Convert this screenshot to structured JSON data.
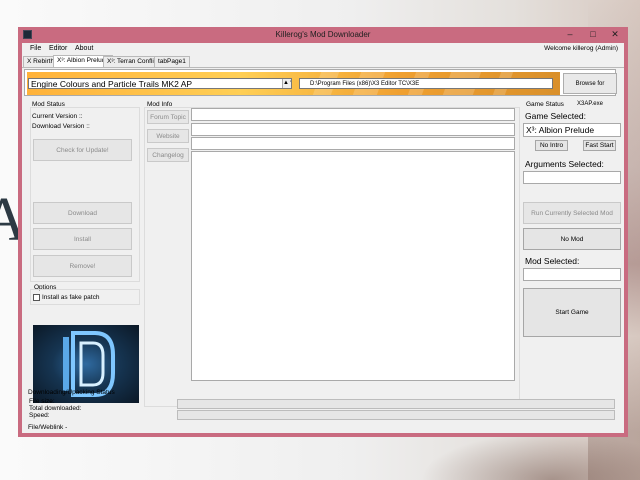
{
  "window": {
    "title": "Killerog's Mod Downloader",
    "minimize": "–",
    "maximize": "□",
    "close": "✕"
  },
  "desktop": {
    "background_letters": "AL"
  },
  "menu": {
    "file": "File",
    "editor": "Editor",
    "about": "About",
    "welcome": "Welcome killerog (Admin)"
  },
  "tabs": [
    "X Rebirth",
    "X³: Albion Prelude",
    "X³: Terran Conflict",
    "tabPage1"
  ],
  "banner": {
    "mod_selected": "Engine Colours and Particle Trails MK2 AP",
    "path": "D:\\Program Files (x86)\\X3 Editor TC\\X3E",
    "browse": "Browse for X3AP.exe"
  },
  "mod_status": {
    "title": "Mod Status",
    "current_version": "Current Version ::",
    "download_version": "Download Version ::",
    "check_update": "Check for Update!",
    "download": "Download",
    "install": "Install",
    "remove": "Remove!"
  },
  "options": {
    "title": "Options",
    "fake_patch": "Install as fake patch"
  },
  "mod_info": {
    "title": "Mod Info",
    "forum_topic": "Forum Topic",
    "website": "Website",
    "changelog": "Changelog"
  },
  "game_status": {
    "title": "Game Status",
    "game_selected_label": "Game Selected:",
    "game_selected_value": "X³: Albion Prelude",
    "no_intro": "No Intro",
    "fast_start": "Fast Start",
    "arguments_label": "Arguments Selected:",
    "run_selected_mod": "Run Currently Selected Mod",
    "no_mod": "No Mod",
    "mod_selected_label": "Mod Selected:",
    "start_game": "Start Game"
  },
  "download_status": {
    "title": "Downloading/Upacking Status",
    "file_size": "File size:",
    "total_downloaded": "Total downloaded:",
    "speed": "Speed:",
    "file_weblink": "File/Weblink -"
  }
}
